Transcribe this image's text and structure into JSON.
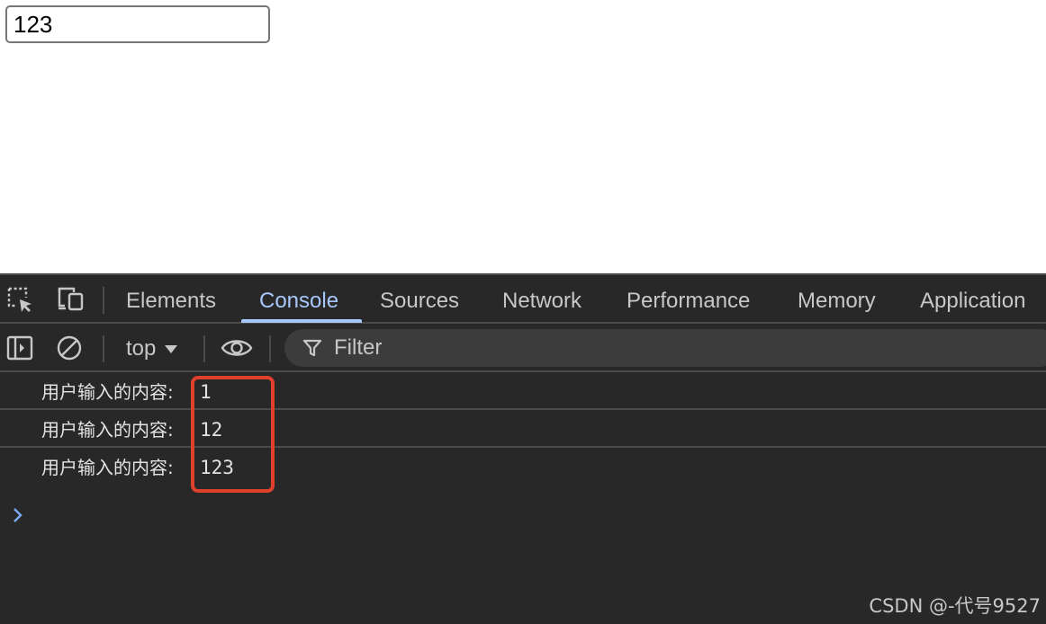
{
  "page": {
    "input_value": "123"
  },
  "devtools": {
    "tabs": [
      {
        "label": "Elements"
      },
      {
        "label": "Console"
      },
      {
        "label": "Sources"
      },
      {
        "label": "Network"
      },
      {
        "label": "Performance"
      },
      {
        "label": "Memory"
      },
      {
        "label": "Application"
      }
    ],
    "active_tab": "Console",
    "toolbar": {
      "context": "top",
      "filter_placeholder": "Filter"
    },
    "console": {
      "logs": [
        {
          "label": "用户输入的内容:",
          "value": "1"
        },
        {
          "label": "用户输入的内容:",
          "value": "12"
        },
        {
          "label": "用户输入的内容:",
          "value": "123"
        }
      ]
    },
    "icons": {
      "inspect": "inspect-element-icon",
      "device": "device-toolbar-icon",
      "sidebar": "sidebar-toggle-icon",
      "clear": "clear-console-icon",
      "eye": "live-expression-eye-icon",
      "filter": "filter-icon",
      "prompt": "prompt-chevron-icon"
    },
    "colors": {
      "background": "#282828",
      "active_tab": "#a8c7fa",
      "text": "#c7c7c7",
      "highlight": "#e0402c"
    }
  },
  "watermark": "CSDN @-代号9527"
}
